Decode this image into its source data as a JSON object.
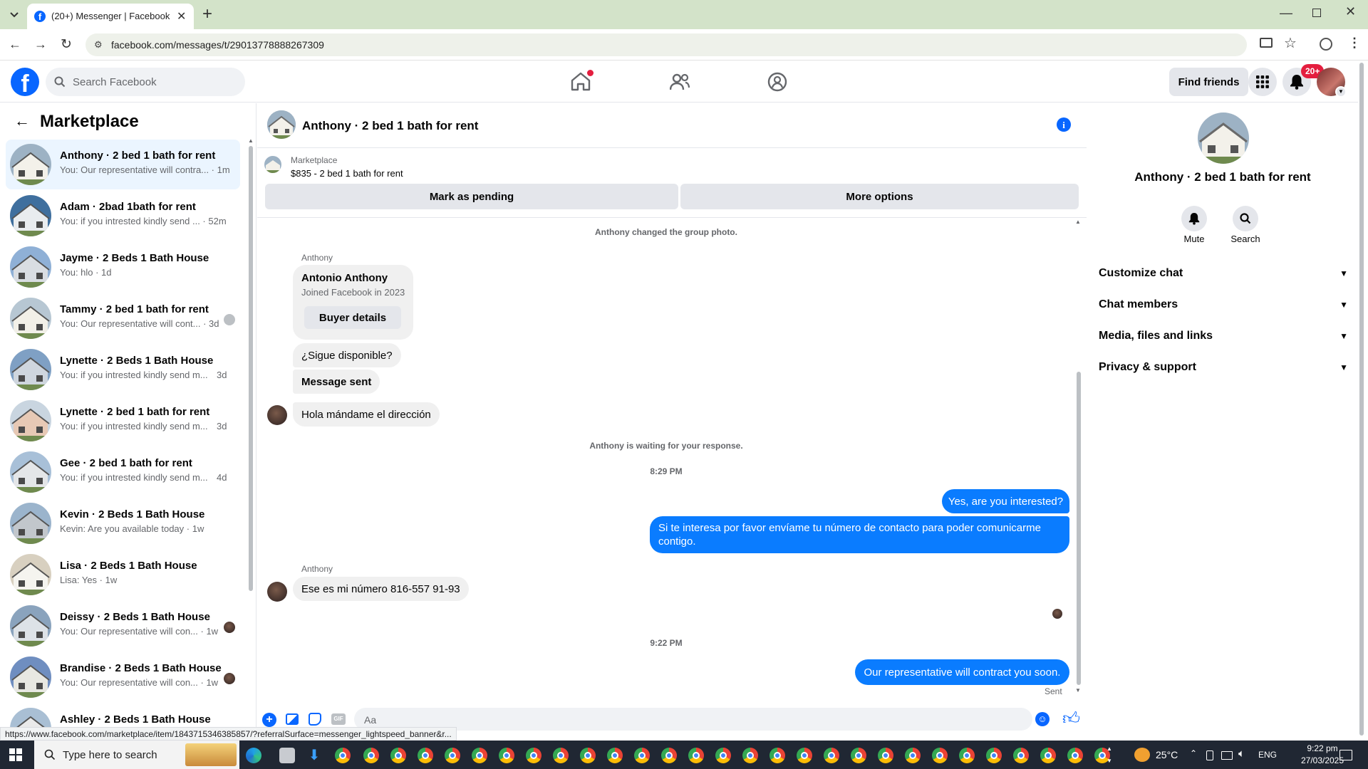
{
  "browser": {
    "tab_title": "(20+) Messenger | Facebook",
    "url": "facebook.com/messages/t/29013778888267309",
    "status_url": "https://www.facebook.com/marketplace/item/1843715346385857/?referralSurface=messenger_lightspeed_banner&r..."
  },
  "fb": {
    "search_placeholder": "Search Facebook",
    "find_friends": "Find friends",
    "notif_badge": "20+"
  },
  "left": {
    "title": "Marketplace",
    "conversations": [
      {
        "name": "Anthony · 2 bed 1 bath for rent",
        "sub": "You: Our representative will contra... · 1m",
        "active": true
      },
      {
        "name": "Adam · 2bad 1bath for rent",
        "sub": "You: if you intrested kindly send ... · 52m"
      },
      {
        "name": "Jayme · 2 Beds 1 Bath House",
        "sub": "You: hlo · 1d"
      },
      {
        "name": "Tammy · 2 bed 1 bath for rent",
        "sub": "You: Our representative will cont... · 3d"
      },
      {
        "name": "Lynette · 2 Beds 1 Bath House",
        "sub": "You: if you intrested kindly send m...",
        "time": "3d"
      },
      {
        "name": "Lynette · 2 bed 1 bath for rent",
        "sub": "You: if you intrested kindly send m...",
        "time": "3d"
      },
      {
        "name": "Gee · 2 bed 1 bath for rent",
        "sub": "You: if you intrested kindly send m...",
        "time": "4d"
      },
      {
        "name": "Kevin · 2 Beds 1 Bath House",
        "sub": "Kevin: Are you available today · 1w"
      },
      {
        "name": "Lisa · 2 Beds 1 Bath House",
        "sub": "Lisa: Yes · 1w"
      },
      {
        "name": "Deissy · 2 Beds 1 Bath House",
        "sub": "You: Our representative will con... · 1w"
      },
      {
        "name": "Brandise · 2 Beds 1 Bath House",
        "sub": "You: Our representative will con... · 1w"
      },
      {
        "name": "Ashley · 2 Beds 1 Bath House",
        "sub": ""
      }
    ]
  },
  "chat": {
    "title": "Anthony · 2 bed 1 bath for rent",
    "marketplace_label": "Marketplace",
    "listing": "$835 - 2 bed 1 bath for rent",
    "mark_pending": "Mark as pending",
    "more_options": "More options",
    "group_photo": "Anthony changed the group photo.",
    "sender1": "Anthony",
    "buyer_name": "Antonio Anthony",
    "buyer_joined": "Joined Facebook in 2023",
    "buyer_details": "Buyer details",
    "msg_sigue": "¿Sigue disponible?",
    "msg_sent_label": "Message sent",
    "msg_hola": "Hola mándame el dirección",
    "waiting": "Anthony is waiting for your response.",
    "time1": "8:29 PM",
    "out1": "Yes, are you interested?",
    "out2": "Si te interesa por favor envíame tu número de contacto para poder comunicarme contigo.",
    "sender2": "Anthony",
    "msg_numero": "Ese es mi número 816-557 91-93",
    "time2": "9:22 PM",
    "out3": "Our representative will contract you soon.",
    "sent": "Sent",
    "composer_placeholder": "Aa"
  },
  "right": {
    "name": "Anthony · 2 bed 1 bath for rent",
    "mute": "Mute",
    "search": "Search",
    "items": [
      "Customize chat",
      "Chat members",
      "Media, files and links",
      "Privacy & support"
    ]
  },
  "taskbar": {
    "search_placeholder": "Type here to search",
    "temp": "25°C",
    "lang": "ENG",
    "time": "9:22 pm",
    "date": "27/03/2025"
  },
  "colors": {
    "fb_blue": "#0866ff",
    "bubble_blue": "#0a7cff",
    "chrome_green": "#d3e3c9"
  }
}
